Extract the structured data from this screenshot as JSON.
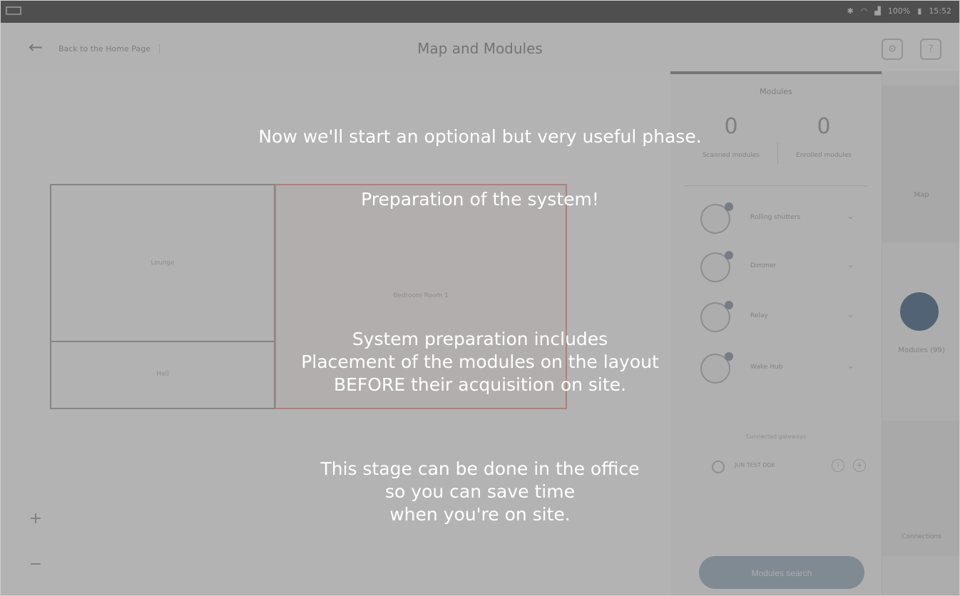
{
  "statusbar": {
    "time": "15:52",
    "battery": "100%"
  },
  "header": {
    "back_label": "Back to the Home Page",
    "title": "Map and Modules"
  },
  "map": {
    "rooms": [
      {
        "label": "Lounge"
      },
      {
        "label": "Hall"
      },
      {
        "label": "Bedroom\nRoom 1"
      }
    ]
  },
  "panel": {
    "title": "Modules",
    "counter_left": {
      "value": "0",
      "label": "Scanned modules"
    },
    "counter_right": {
      "value": "0",
      "label": "Enrolled modules"
    },
    "modules": [
      {
        "name": "Rolling shutters"
      },
      {
        "name": "Dimmer"
      },
      {
        "name": "Relay"
      },
      {
        "name": "Wake Hub"
      }
    ],
    "gateway_caption": "Connected gateways",
    "gateway_name": "JUN TEST DOK",
    "search_button": "Modules search"
  },
  "rail": {
    "map": "Map",
    "modules": "Modules (99)",
    "connections": "Connections"
  },
  "overlay": {
    "line1": "Now we'll start an optional but very useful phase.",
    "line2": "Preparation of the system!",
    "line3a": "System preparation includes",
    "line3b": "Placement of the modules on the layout",
    "line3c": "BEFORE their acquisition on site.",
    "line4a": "This stage can be done in the office",
    "line4b": "so you can save time",
    "line4c": "when you're on site."
  },
  "colors": {
    "overlay": "#555555",
    "accent": "#4f6d8a",
    "room_highlight": "#e3a3a3"
  }
}
